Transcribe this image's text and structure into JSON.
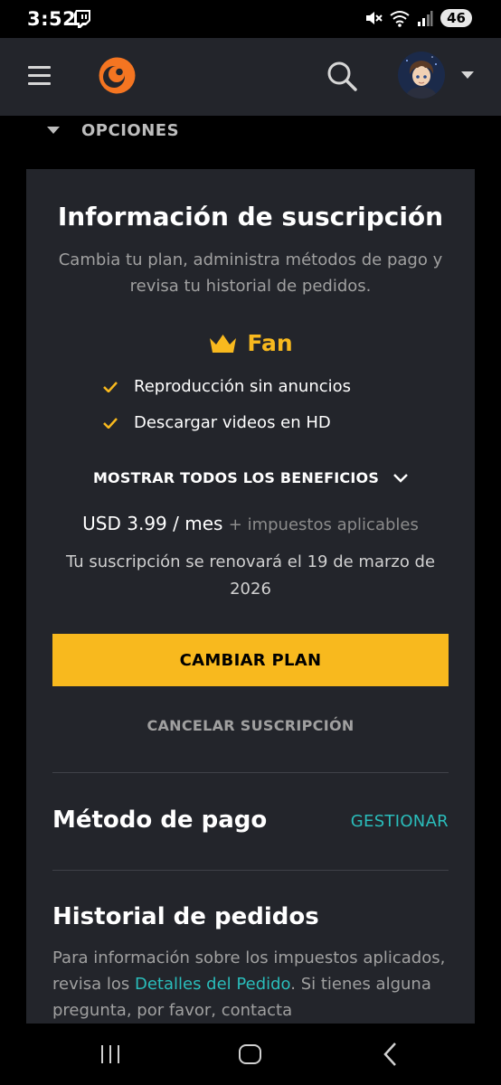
{
  "status_bar": {
    "time": "3:52",
    "battery": "46"
  },
  "header": {
    "options_label": "OPCIONES"
  },
  "subscription": {
    "title": "Información de suscripción",
    "subtitle": "Cambia tu plan, administra métodos de pago y revisa tu historial de pedidos.",
    "plan_name": "Fan",
    "benefits": [
      "Reproducción sin anuncios",
      "Descargar videos en HD"
    ],
    "show_all_label": "MOSTRAR TODOS LOS BENEFICIOS",
    "price": "USD 3.99 / mes",
    "price_tax": "+ impuestos aplicables",
    "renewal_text": "Tu suscripción se renovará el 19 de marzo de 2026",
    "change_plan_label": "CAMBIAR PLAN",
    "cancel_label": "CANCELAR SUSCRIPCIÓN"
  },
  "payment": {
    "title": "Método de pago",
    "manage_label": "GESTIONAR"
  },
  "history": {
    "title": "Historial de pedidos",
    "text_before": "Para información sobre los impuestos aplicados, revisa los ",
    "link": "Detalles del Pedido",
    "text_after": ". Si tienes alguna pregunta, por favor, contacta"
  },
  "colors": {
    "accent_yellow": "#f8b91e",
    "accent_teal": "#2abdbb",
    "brand_orange": "#f47521",
    "card_bg": "#23252b"
  }
}
